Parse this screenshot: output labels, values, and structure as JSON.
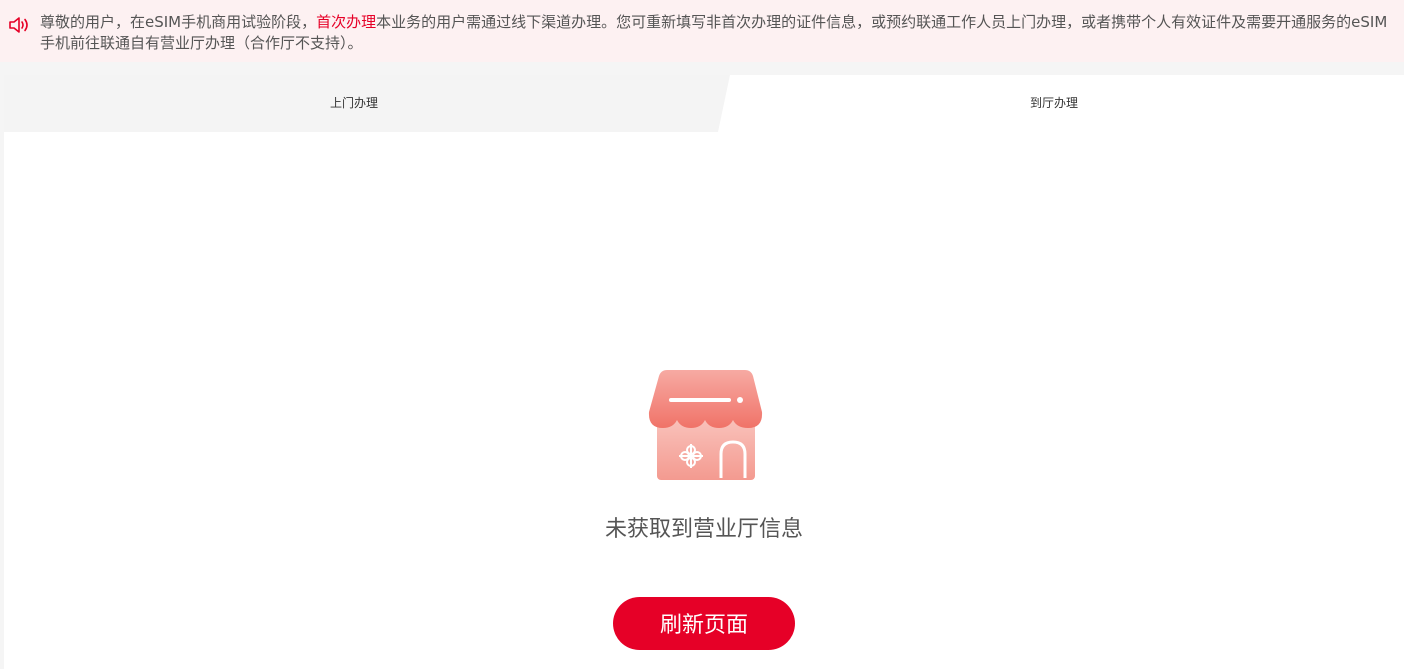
{
  "notice": {
    "icon": "speaker-icon",
    "text_before": "尊敬的用户，在eSIM手机商用试验阶段，",
    "highlight": "首次办理",
    "text_after": "本业务的用户需通过线下渠道办理。您可重新填写非首次办理的证件信息，或预约联通工作人员上门办理，或者携带个人有效证件及需要开通服务的eSIM手机前往联通自有营业厅办理（合作厅不支持）。",
    "highlight_color": "#e60027"
  },
  "tabs": [
    {
      "label": "上门办理",
      "active": false
    },
    {
      "label": "到厅办理",
      "active": true
    }
  ],
  "empty_state": {
    "icon": "store-icon",
    "message": "未获取到营业厅信息"
  },
  "refresh_button": {
    "label": "刷新页面",
    "color": "#e60027"
  }
}
